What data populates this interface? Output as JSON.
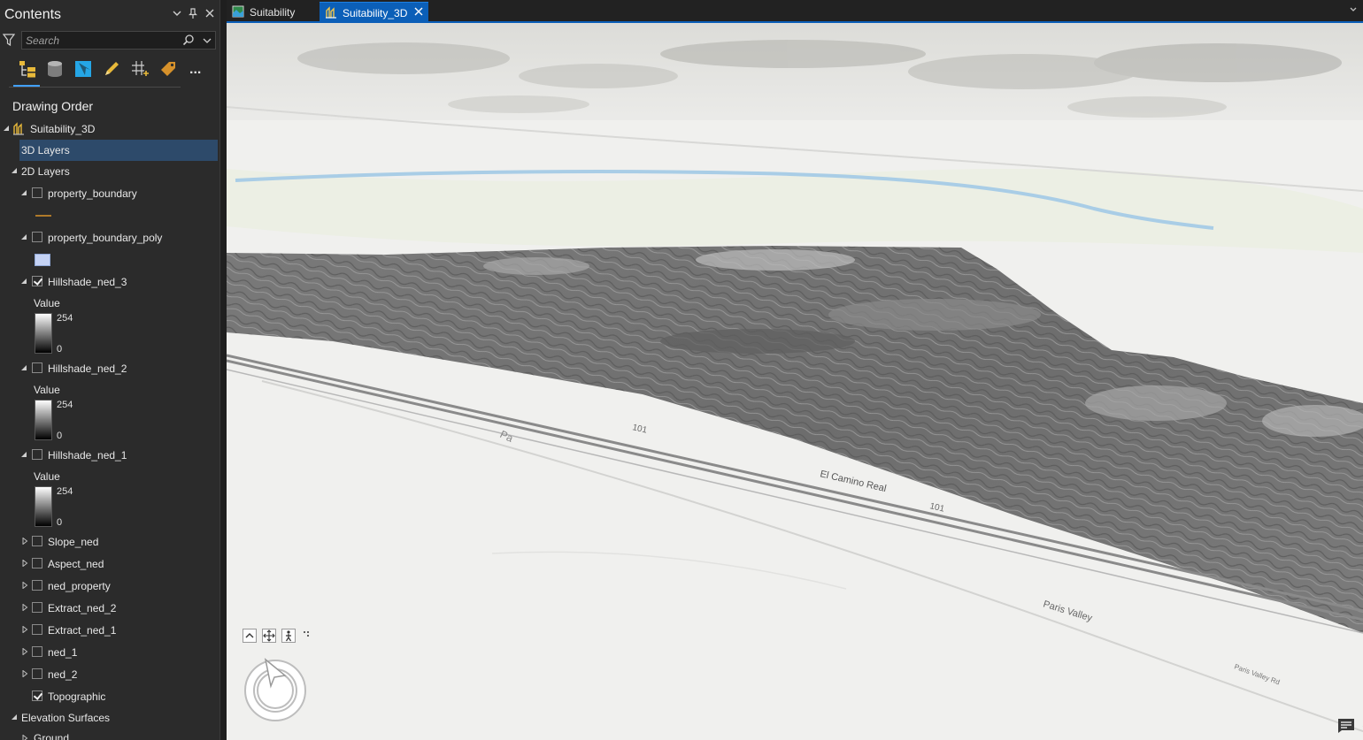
{
  "contents_pane": {
    "title": "Contents",
    "search": {
      "placeholder": "Search",
      "value": ""
    },
    "toolbar": {
      "icons": [
        "list-by-drawing-order-icon",
        "list-by-source-icon",
        "list-by-selection-icon",
        "list-by-editing-icon",
        "list-by-snapping-icon",
        "list-by-labeling-icon",
        "more-icon"
      ],
      "more_label": "...",
      "active_index": 0
    },
    "section_title": "Drawing Order",
    "tree": {
      "map": "Suitability_3D",
      "group_3d": "3D Layers",
      "group_2d": "2D Layers",
      "layers": [
        {
          "name": "property_boundary",
          "checked": false,
          "expanded": true,
          "legend": "line"
        },
        {
          "name": "property_boundary_poly",
          "checked": false,
          "expanded": true,
          "legend": "polygon"
        },
        {
          "name": "Hillshade_ned_3",
          "checked": true,
          "expanded": true,
          "legend": "ramp",
          "ramp_title": "Value",
          "ramp_high": "254",
          "ramp_low": "0"
        },
        {
          "name": "Hillshade_ned_2",
          "checked": false,
          "expanded": true,
          "legend": "ramp",
          "ramp_title": "Value",
          "ramp_high": "254",
          "ramp_low": "0"
        },
        {
          "name": "Hillshade_ned_1",
          "checked": false,
          "expanded": true,
          "legend": "ramp",
          "ramp_title": "Value",
          "ramp_high": "254",
          "ramp_low": "0"
        },
        {
          "name": "Slope_ned",
          "checked": false,
          "expanded": false
        },
        {
          "name": "Aspect_ned",
          "checked": false,
          "expanded": false
        },
        {
          "name": "ned_property",
          "checked": false,
          "expanded": false
        },
        {
          "name": "Extract_ned_2",
          "checked": false,
          "expanded": false
        },
        {
          "name": "Extract_ned_1",
          "checked": false,
          "expanded": false
        },
        {
          "name": "ned_1",
          "checked": false,
          "expanded": false
        },
        {
          "name": "ned_2",
          "checked": false,
          "expanded": false
        },
        {
          "name": "Topographic",
          "checked": true,
          "expanded": false,
          "no_expander": true
        }
      ],
      "elevation_group": "Elevation Surfaces",
      "ground": "Ground"
    }
  },
  "tabs": [
    {
      "label": "Suitability",
      "active": false,
      "icon": "map-icon"
    },
    {
      "label": "Suitability_3D",
      "active": true,
      "icon": "scene-icon"
    }
  ],
  "map": {
    "labels": {
      "highway": "El Camino Real",
      "route": "101",
      "road1": "Paris Valley",
      "road2": "Paris Valley Rd",
      "road3": "Pa"
    }
  },
  "colors": {
    "accent": "#0b5fb8",
    "selection": "#2d4a6a",
    "pane_bg": "#2b2b2b"
  }
}
